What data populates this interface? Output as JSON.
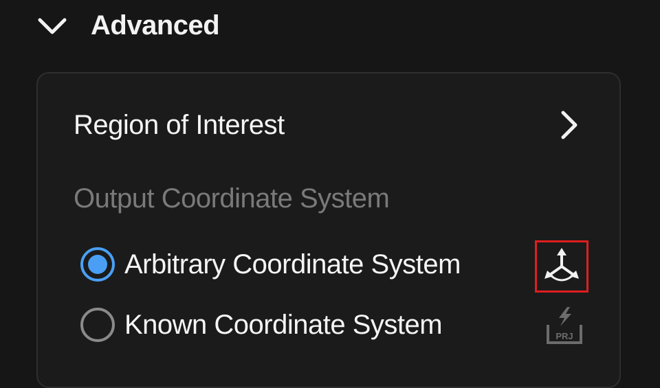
{
  "section": {
    "title": "Advanced",
    "expanded": true,
    "toggle_icon": "chevron-down-icon"
  },
  "region_of_interest": {
    "label": "Region of Interest",
    "icon": "chevron-right-icon"
  },
  "output_coordinate_system": {
    "label": "Output Coordinate System",
    "options": [
      {
        "label": "Arbitrary Coordinate System",
        "selected": true,
        "icon": "coordinate-axes-icon"
      },
      {
        "label": "Known Coordinate System",
        "selected": false,
        "icon": "known-crs-icon",
        "icon_text": "PRJ"
      }
    ]
  },
  "colors": {
    "background": "#161616",
    "panel": "#1b1b1b",
    "accent": "#4a9ff5",
    "highlight": "#e01e1e",
    "muted_text": "#7a7a7a"
  }
}
